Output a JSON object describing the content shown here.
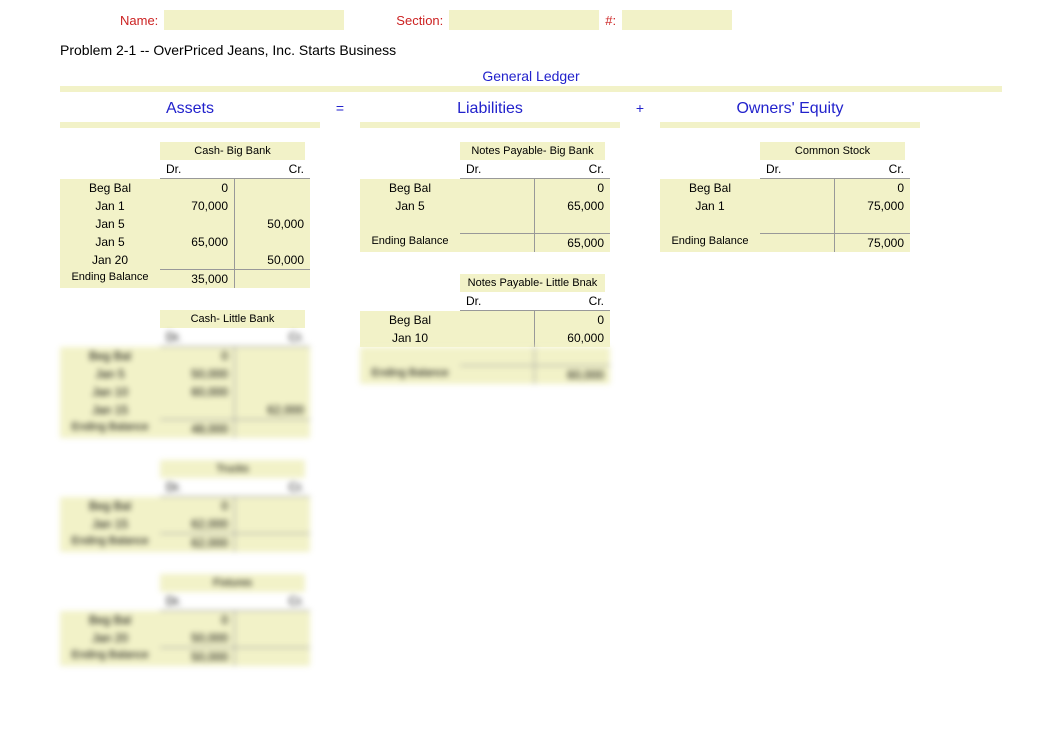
{
  "header": {
    "nameLabel": "Name:",
    "sectionLabel": "Section:",
    "numLabel": "#:"
  },
  "problem": "Problem 2-1 -- OverPriced Jeans, Inc. Starts Business",
  "ledgerTitle": "General Ledger",
  "cols": {
    "assets": "Assets",
    "eq": "=",
    "liab": "Liabilities",
    "plus": "+",
    "oe": "Owners' Equity"
  },
  "drLabel": "Dr.",
  "crLabel": "Cr.",
  "begBal": "Beg Bal",
  "endBal": "Ending Balance",
  "accounts": {
    "cashBigBank": {
      "title": "Cash- Big Bank",
      "rows": [
        {
          "lbl": "Beg Bal",
          "dr": "0",
          "cr": ""
        },
        {
          "lbl": "Jan 1",
          "dr": "70,000",
          "cr": ""
        },
        {
          "lbl": "Jan 5",
          "dr": "",
          "cr": "50,000"
        },
        {
          "lbl": "Jan 5",
          "dr": "65,000",
          "cr": ""
        },
        {
          "lbl": "Jan 20",
          "dr": "",
          "cr": "50,000"
        }
      ],
      "end": {
        "dr": "35,000",
        "cr": ""
      }
    },
    "cashLittleBank": {
      "title": "Cash- Little Bank",
      "rows": [
        {
          "lbl": "Beg Bal",
          "dr": "0",
          "cr": ""
        },
        {
          "lbl": "Jan 5",
          "dr": "50,000",
          "cr": ""
        },
        {
          "lbl": "Jan 10",
          "dr": "60,000",
          "cr": ""
        },
        {
          "lbl": "Jan 15",
          "dr": "",
          "cr": "62,000"
        }
      ],
      "end": {
        "dr": "48,000",
        "cr": ""
      }
    },
    "trucks": {
      "title": "Trucks",
      "rows": [
        {
          "lbl": "Beg Bal",
          "dr": "0",
          "cr": ""
        },
        {
          "lbl": "Jan 15",
          "dr": "62,000",
          "cr": ""
        }
      ],
      "end": {
        "dr": "62,000",
        "cr": ""
      }
    },
    "fixtures": {
      "title": "Fixtures",
      "rows": [
        {
          "lbl": "Beg Bal",
          "dr": "0",
          "cr": ""
        },
        {
          "lbl": "Jan 20",
          "dr": "50,000",
          "cr": ""
        }
      ],
      "end": {
        "dr": "50,000",
        "cr": ""
      }
    },
    "npBigBank": {
      "title": "Notes Payable- Big Bank",
      "rows": [
        {
          "lbl": "Beg Bal",
          "dr": "",
          "cr": "0"
        },
        {
          "lbl": "Jan 5",
          "dr": "",
          "cr": "65,000"
        }
      ],
      "end": {
        "dr": "",
        "cr": "65,000"
      }
    },
    "npLittleBank": {
      "title": "Notes Payable- Little Bnak",
      "rows": [
        {
          "lbl": "Beg Bal",
          "dr": "",
          "cr": "0"
        },
        {
          "lbl": "Jan 10",
          "dr": "",
          "cr": "60,000"
        }
      ],
      "end": {
        "dr": "",
        "cr": "60,000"
      }
    },
    "commonStock": {
      "title": "Common Stock",
      "rows": [
        {
          "lbl": "Beg Bal",
          "dr": "",
          "cr": "0"
        },
        {
          "lbl": "Jan 1",
          "dr": "",
          "cr": "75,000"
        }
      ],
      "end": {
        "dr": "",
        "cr": "75,000"
      }
    }
  }
}
